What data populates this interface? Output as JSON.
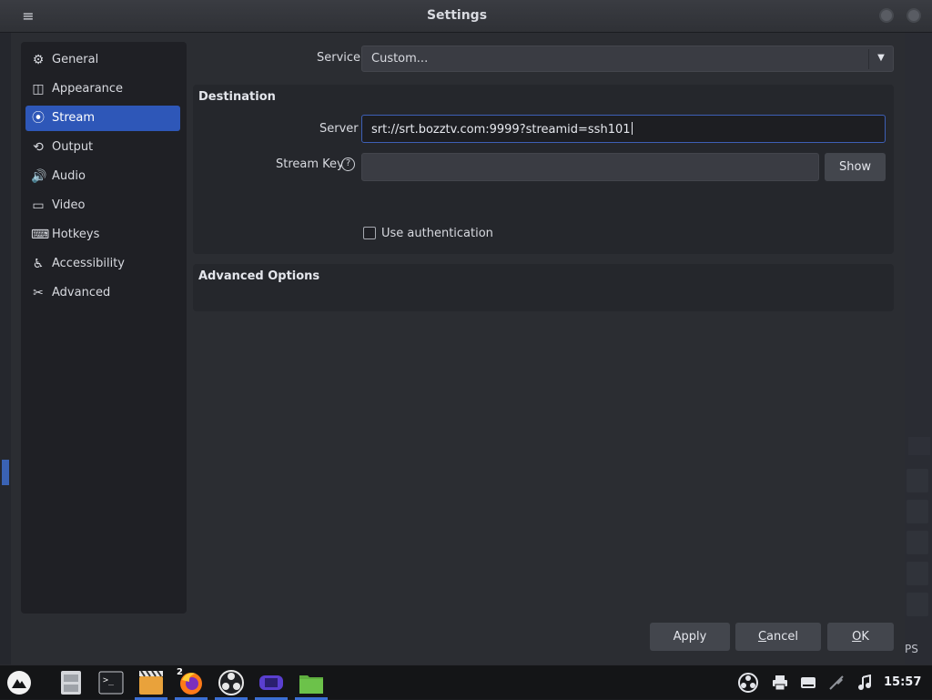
{
  "window": {
    "title": "Settings",
    "menu_icon": "≡"
  },
  "sidebar": {
    "items": [
      {
        "label": "General",
        "icon": "gear-icon",
        "glyph": "⚙"
      },
      {
        "label": "Appearance",
        "icon": "appearance-icon",
        "glyph": "◫"
      },
      {
        "label": "Stream",
        "icon": "antenna-icon",
        "glyph": "⦿"
      },
      {
        "label": "Output",
        "icon": "output-icon",
        "glyph": "⟲"
      },
      {
        "label": "Audio",
        "icon": "speaker-icon",
        "glyph": "🔊"
      },
      {
        "label": "Video",
        "icon": "monitor-icon",
        "glyph": "▭"
      },
      {
        "label": "Hotkeys",
        "icon": "keyboard-icon",
        "glyph": "⌨"
      },
      {
        "label": "Accessibility",
        "icon": "accessibility-icon",
        "glyph": "♿"
      },
      {
        "label": "Advanced",
        "icon": "tools-icon",
        "glyph": "✂"
      }
    ],
    "active": "Stream"
  },
  "service": {
    "label": "Service",
    "value": "Custom...",
    "caret": "▼"
  },
  "destination": {
    "title": "Destination",
    "server_label": "Server",
    "server_value": "srt://srt.bozztv.com:9999?streamid=ssh101",
    "stream_key_label": "Stream Key",
    "help_glyph": "?",
    "stream_key_value": "",
    "show_label": "Show",
    "auth_label": "Use authentication",
    "auth_checked": false
  },
  "advanced_options": {
    "title": "Advanced Options"
  },
  "buttons": {
    "apply": "Apply",
    "cancel_first": "C",
    "cancel_rest": "ancel",
    "ok_first": "O",
    "ok_rest": "K"
  },
  "background": {
    "right_text": "PS"
  },
  "taskbar": {
    "firefox_badge": "2",
    "clock": "15:57"
  },
  "colors": {
    "accent": "#2e57b8",
    "dialog_bg": "#2b2d32",
    "group_bg": "#25272c"
  }
}
